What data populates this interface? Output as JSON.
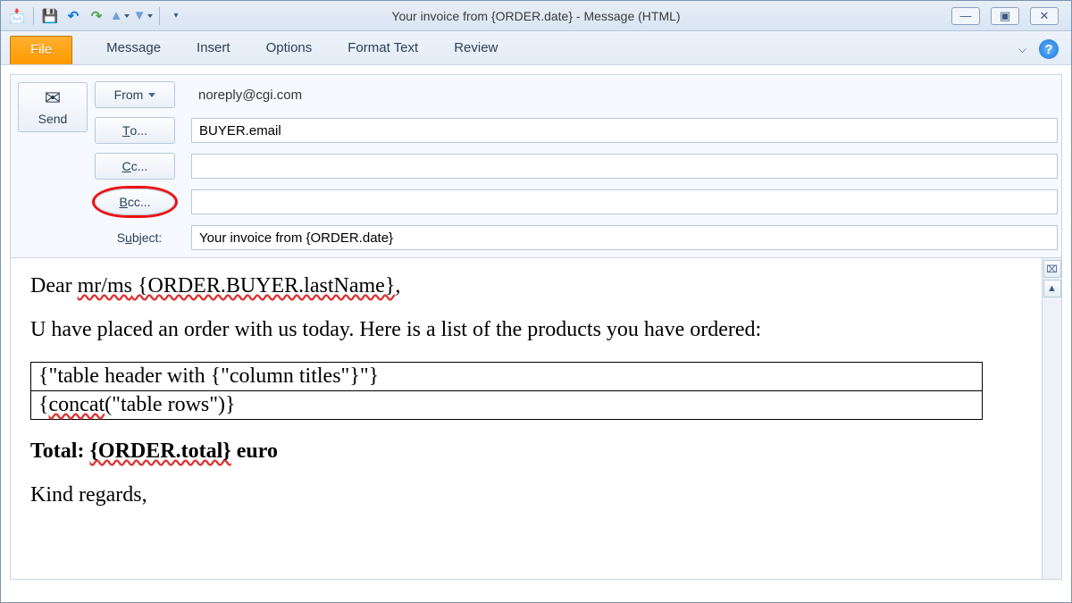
{
  "window": {
    "title": "Your invoice from {ORDER.date}  -  Message (HTML)"
  },
  "qat": {
    "tooltip_newmail": "New Mail",
    "tooltip_save": "Save",
    "tooltip_undo": "Undo",
    "tooltip_redo": "Redo",
    "tooltip_prev": "Previous Item",
    "tooltip_next": "Next Item"
  },
  "ribbon": {
    "file": "File",
    "tabs": [
      "Message",
      "Insert",
      "Options",
      "Format Text",
      "Review"
    ]
  },
  "compose": {
    "send": "Send",
    "from_label": "From",
    "from_value": "noreply@cgi.com",
    "to_label": "To...",
    "to_value": "BUYER.email",
    "cc_label": "Cc...",
    "cc_value": "",
    "bcc_label": "Bcc...",
    "bcc_value": "",
    "subject_label": "Subject:",
    "subject_value": "Your invoice from {ORDER.date}"
  },
  "body": {
    "greeting_prefix": "Dear ",
    "greeting_salutation": "mr/ms",
    "greeting_name": " {ORDER.BUYER.lastName}",
    "greeting_suffix": ",",
    "intro": "U have placed an order with us today. Here is a list of the products you have ordered:",
    "table_header": "{\"table header with {\"column titles\"}\"}",
    "table_rows_prefix": "{",
    "table_rows_fn": "concat",
    "table_rows_arg": "(\"table rows\")}",
    "total_label": "Total: ",
    "total_value": "{ORDER.total}",
    "total_suffix": " euro",
    "signoff": "Kind regards,"
  }
}
